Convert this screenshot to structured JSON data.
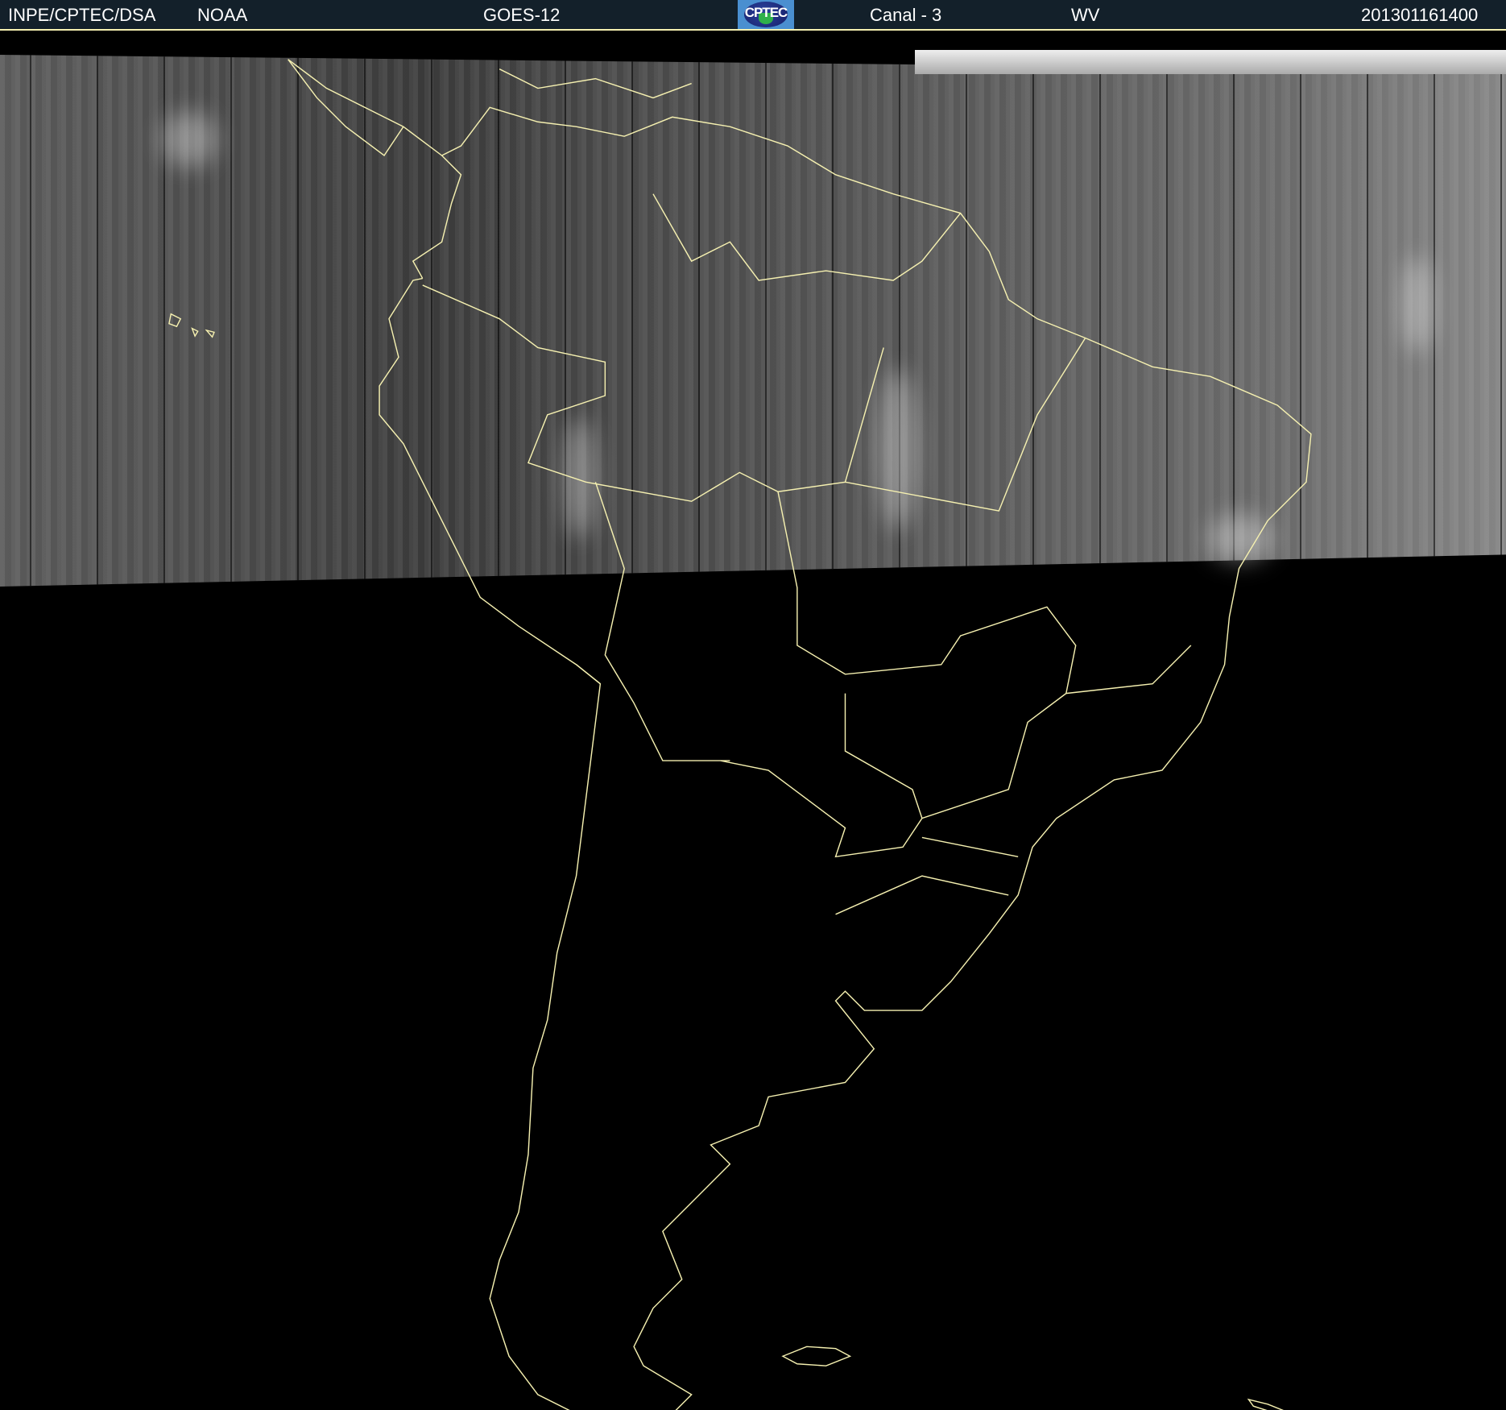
{
  "header": {
    "agency": "INPE/CPTEC/DSA",
    "provider": "NOAA",
    "satellite": "GOES-12",
    "logo_text": "CPTEC",
    "channel": "Canal - 3",
    "band": "WV",
    "timestamp": "201301161400"
  },
  "colors": {
    "header_bg": "#13202a",
    "coastline": "#f5f0b0"
  }
}
